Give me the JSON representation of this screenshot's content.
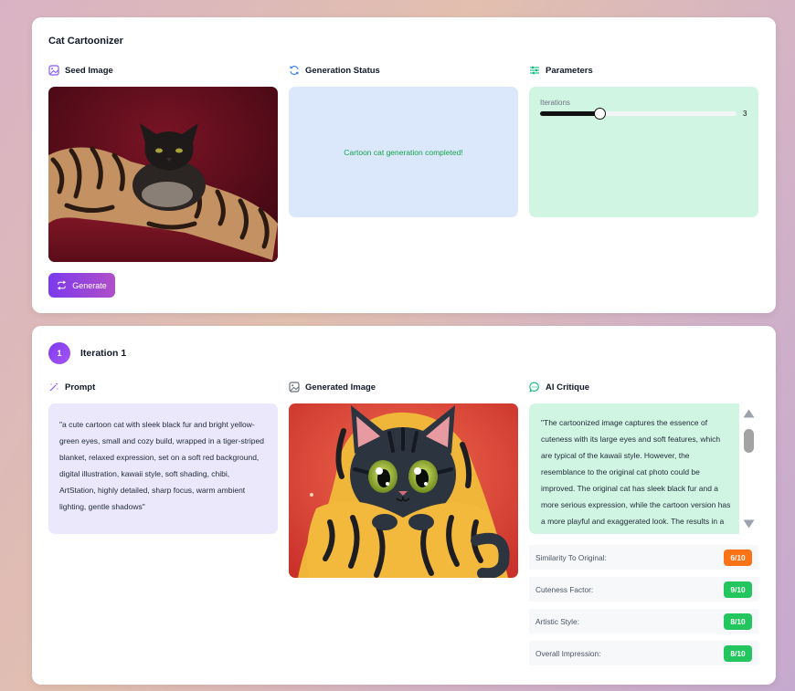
{
  "app": {
    "title": "Cat Cartoonizer"
  },
  "seed": {
    "label": "Seed Image",
    "generate_label": "Generate"
  },
  "status": {
    "label": "Generation Status",
    "message": "Cartoon cat generation completed!"
  },
  "params": {
    "label": "Parameters",
    "iterations_label": "Iterations",
    "iterations_value": "3",
    "iterations_fraction": 0.3
  },
  "iteration": {
    "number": "1",
    "title": "Iteration 1",
    "prompt_label": "Prompt",
    "prompt_text": "\"a cute cartoon cat with sleek black fur and bright yellow-green eyes, small and cozy build, wrapped in a tiger-striped blanket, relaxed expression, set on a soft red background, digital illustration, kawaii style, soft shading, chibi, ArtStation, highly detailed, sharp focus, warm ambient lighting, gentle shadows\"",
    "image_label": "Generated Image",
    "critique_label": "AI Critique",
    "critique_text": "\"The cartoonized image captures the essence of cuteness with its large eyes and soft features, which are typical of the kawaii style. However, the resemblance to the original cat photo could be improved. The original cat has sleek black fur and a more serious expression, while the cartoon version has a more playful and exaggerated look. The results in a less accurate representation.",
    "scores": [
      {
        "label": "Similarity To Original:",
        "value": "6/10",
        "color": "#f97316"
      },
      {
        "label": "Cuteness Factor:",
        "value": "9/10",
        "color": "#22c55e"
      },
      {
        "label": "Artistic Style:",
        "value": "8/10",
        "color": "#22c55e"
      },
      {
        "label": "Overall Impression:",
        "value": "8/10",
        "color": "#22c55e"
      }
    ]
  },
  "colors": {
    "accent": "#7c3aed",
    "status_bg": "#dbe8fb",
    "params_bg": "#d1f5e3",
    "prompt_bg": "#ece8fc",
    "success_text": "#16a34a"
  }
}
